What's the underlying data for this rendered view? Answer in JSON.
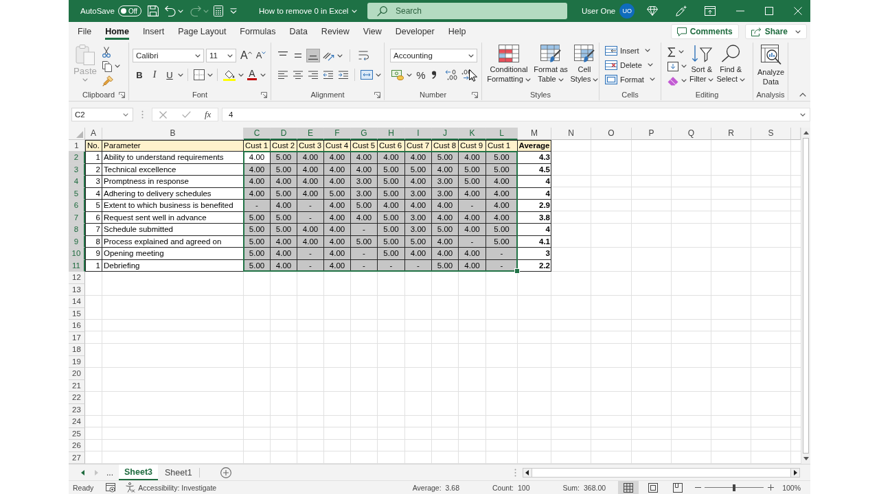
{
  "title_bar": {
    "autosave": {
      "label": "AutoSave",
      "toggle": "Off",
      "on": false
    },
    "redo": {
      "disabled": true
    },
    "title": "How to remove 0 in Excel",
    "search": {
      "placeholder": "Search"
    },
    "user": {
      "name": "User One",
      "initials": "UO"
    }
  },
  "menu": {
    "tabs": [
      {
        "label": "File",
        "selected": false
      },
      {
        "label": "Home",
        "selected": true
      },
      {
        "label": "Insert",
        "selected": false
      },
      {
        "label": "Page Layout",
        "selected": false
      },
      {
        "label": "Formulas",
        "selected": false
      },
      {
        "label": "Data",
        "selected": false
      },
      {
        "label": "Review",
        "selected": false
      },
      {
        "label": "View",
        "selected": false
      },
      {
        "label": "Developer",
        "selected": false
      },
      {
        "label": "Help",
        "selected": false
      }
    ],
    "comments": "Comments",
    "share": "Share"
  },
  "ribbon": {
    "clipboard": {
      "label": "Clipboard",
      "paste": {
        "label": "Paste",
        "disabled": true
      }
    },
    "font": {
      "label": "Font",
      "name": "Calibri",
      "size": "11",
      "grow": "A",
      "shrink": "A",
      "bold": "B",
      "italic": "I",
      "underline": "U",
      "font_color": "A"
    },
    "alignment": {
      "label": "Alignment",
      "vertical": [
        {
          "kind": "top",
          "selected": false
        },
        {
          "kind": "middle",
          "selected": false
        },
        {
          "kind": "bottom",
          "selected": true
        }
      ]
    },
    "number": {
      "label": "Number",
      "format": "Accounting",
      "percent": "%"
    },
    "styles": {
      "label": "Styles",
      "buttons": [
        {
          "kind": "conditional",
          "lines": [
            "Conditional",
            "Formatting"
          ]
        },
        {
          "kind": "table",
          "lines": [
            "Format as",
            "Table"
          ]
        },
        {
          "kind": "cell_styles",
          "lines": [
            "Cell",
            "Styles"
          ]
        }
      ]
    },
    "cells": {
      "label": "Cells",
      "buttons": [
        {
          "kind": "insert",
          "label": "Insert"
        },
        {
          "kind": "delete",
          "label": "Delete"
        },
        {
          "kind": "format",
          "label": "Format"
        }
      ]
    },
    "editing": {
      "label": "Editing",
      "buttons": [
        {
          "kind": "sort",
          "lines": [
            "Sort &",
            "Filter"
          ]
        },
        {
          "kind": "find",
          "lines": [
            "Find &",
            "Select"
          ]
        }
      ]
    },
    "analysis": {
      "label": "Analysis",
      "lines": [
        "Analyze",
        "Data"
      ]
    }
  },
  "formula_bar": {
    "name_box": "C2",
    "function_label": "fx",
    "value": "4"
  },
  "sheet": {
    "columns": [
      {
        "label": "A",
        "kind": "index",
        "selected": false
      },
      {
        "label": "B",
        "kind": "text",
        "selected": false
      },
      {
        "label": "C",
        "kind": "value",
        "selected": true
      },
      {
        "label": "D",
        "kind": "value",
        "selected": true
      },
      {
        "label": "E",
        "kind": "value",
        "selected": true
      },
      {
        "label": "F",
        "kind": "value",
        "selected": true
      },
      {
        "label": "G",
        "kind": "value",
        "selected": true
      },
      {
        "label": "H",
        "kind": "value",
        "selected": true
      },
      {
        "label": "I",
        "kind": "value",
        "selected": true
      },
      {
        "label": "J",
        "kind": "value",
        "selected": true
      },
      {
        "label": "K",
        "kind": "value",
        "selected": true
      },
      {
        "label": "L",
        "kind": "value",
        "selected": true
      },
      {
        "label": "M",
        "kind": "total",
        "selected": false
      },
      {
        "label": "N",
        "kind": "empty",
        "selected": false
      },
      {
        "label": "O",
        "kind": "empty",
        "selected": false
      },
      {
        "label": "P",
        "kind": "empty",
        "selected": false
      },
      {
        "label": "Q",
        "kind": "empty",
        "selected": false
      },
      {
        "label": "R",
        "kind": "empty",
        "selected": false
      },
      {
        "label": "S",
        "kind": "empty",
        "selected": false
      }
    ],
    "rows": [
      {
        "label": "1",
        "kind": "header",
        "selected": false,
        "cells": [
          "No.",
          "Parameter",
          "Cust 1",
          "Cust 2",
          "Cust 3",
          "Cust 4",
          "Cust 5",
          "Cust 6",
          "Cust 7",
          "Cust 8",
          "Cust 9",
          "Cust 1",
          "Average"
        ]
      },
      {
        "label": "2",
        "kind": "data",
        "selected": true,
        "cells": [
          "1",
          "Ability to understand requirements",
          "4.00",
          "5.00",
          "4.00",
          "4.00",
          "4.00",
          "4.00",
          "4.00",
          "5.00",
          "4.00",
          "5.00",
          "4.3"
        ]
      },
      {
        "label": "3",
        "kind": "data",
        "selected": true,
        "cells": [
          "2",
          "Technical excellence",
          "4.00",
          "5.00",
          "4.00",
          "4.00",
          "4.00",
          "5.00",
          "5.00",
          "4.00",
          "5.00",
          "5.00",
          "4.5"
        ]
      },
      {
        "label": "4",
        "kind": "data",
        "selected": true,
        "cells": [
          "3",
          "Promptness in response",
          "4.00",
          "4.00",
          "4.00",
          "4.00",
          "3.00",
          "5.00",
          "4.00",
          "3.00",
          "5.00",
          "4.00",
          "4"
        ]
      },
      {
        "label": "5",
        "kind": "data",
        "selected": true,
        "cells": [
          "4",
          "Adhering to delivery schedules",
          "4.00",
          "5.00",
          "4.00",
          "5.00",
          "3.00",
          "5.00",
          "3.00",
          "3.00",
          "4.00",
          "4.00",
          "4"
        ]
      },
      {
        "label": "6",
        "kind": "data",
        "selected": true,
        "cells": [
          "5",
          "Extent to which business is benefited",
          "-",
          "4.00",
          "-",
          "4.00",
          "5.00",
          "4.00",
          "4.00",
          "4.00",
          "-",
          "4.00",
          "2.9"
        ]
      },
      {
        "label": "7",
        "kind": "data",
        "selected": true,
        "cells": [
          "6",
          "Request sent well in advance",
          "5.00",
          "5.00",
          "-",
          "4.00",
          "4.00",
          "5.00",
          "3.00",
          "4.00",
          "4.00",
          "4.00",
          "3.8"
        ]
      },
      {
        "label": "8",
        "kind": "data",
        "selected": true,
        "cells": [
          "7",
          "Schedule submitted",
          "5.00",
          "5.00",
          "4.00",
          "4.00",
          "-",
          "5.00",
          "3.00",
          "5.00",
          "4.00",
          "5.00",
          "4"
        ]
      },
      {
        "label": "9",
        "kind": "data",
        "selected": true,
        "cells": [
          "8",
          "Process explained and agreed on",
          "5.00",
          "4.00",
          "4.00",
          "4.00",
          "5.00",
          "5.00",
          "5.00",
          "4.00",
          "-",
          "5.00",
          "4.1"
        ]
      },
      {
        "label": "10",
        "kind": "data",
        "selected": true,
        "cells": [
          "9",
          "Opening meeting",
          "5.00",
          "4.00",
          "-",
          "4.00",
          "-",
          "5.00",
          "4.00",
          "4.00",
          "4.00",
          "-",
          "3"
        ]
      },
      {
        "label": "11",
        "kind": "data",
        "selected": true,
        "cells": [
          "1",
          "Debriefing",
          "5.00",
          "4.00",
          "-",
          "4.00",
          "-",
          "-",
          "-",
          "5.00",
          "4.00",
          "-",
          "2.2"
        ]
      },
      {
        "label": "12",
        "kind": "empty",
        "selected": false
      },
      {
        "label": "13",
        "kind": "empty",
        "selected": false
      },
      {
        "label": "14",
        "kind": "empty",
        "selected": false
      },
      {
        "label": "15",
        "kind": "empty",
        "selected": false
      },
      {
        "label": "16",
        "kind": "empty",
        "selected": false
      },
      {
        "label": "17",
        "kind": "empty",
        "selected": false
      },
      {
        "label": "18",
        "kind": "empty",
        "selected": false
      },
      {
        "label": "19",
        "kind": "empty",
        "selected": false
      },
      {
        "label": "20",
        "kind": "empty",
        "selected": false
      },
      {
        "label": "21",
        "kind": "empty",
        "selected": false
      },
      {
        "label": "22",
        "kind": "empty",
        "selected": false
      },
      {
        "label": "23",
        "kind": "empty",
        "selected": false
      },
      {
        "label": "24",
        "kind": "empty",
        "selected": false
      },
      {
        "label": "25",
        "kind": "empty",
        "selected": false
      },
      {
        "label": "26",
        "kind": "empty",
        "selected": false
      },
      {
        "label": "27",
        "kind": "empty",
        "selected": false
      }
    ]
  },
  "sheet_tabs": {
    "nav": [
      {
        "kind": "previous",
        "disabled": false
      },
      {
        "kind": "next",
        "disabled": true
      }
    ],
    "overflow": "...",
    "tabs": [
      {
        "label": "Sheet3",
        "selected": true
      },
      {
        "label": "Sheet1",
        "selected": false
      }
    ]
  },
  "status_bar": {
    "mode": "Ready",
    "accessibility": "Accessibility: Investigate",
    "stats": [
      {
        "label": "Average:",
        "value": "3.68"
      },
      {
        "label": "Count:",
        "value": "100"
      },
      {
        "label": "Sum:",
        "value": "368.00"
      }
    ],
    "views": [
      {
        "kind": "normal",
        "selected": true
      },
      {
        "kind": "page_layout",
        "selected": false
      },
      {
        "kind": "page_break",
        "selected": false
      }
    ],
    "zoom": {
      "level": 0.5,
      "label": "100%"
    }
  }
}
